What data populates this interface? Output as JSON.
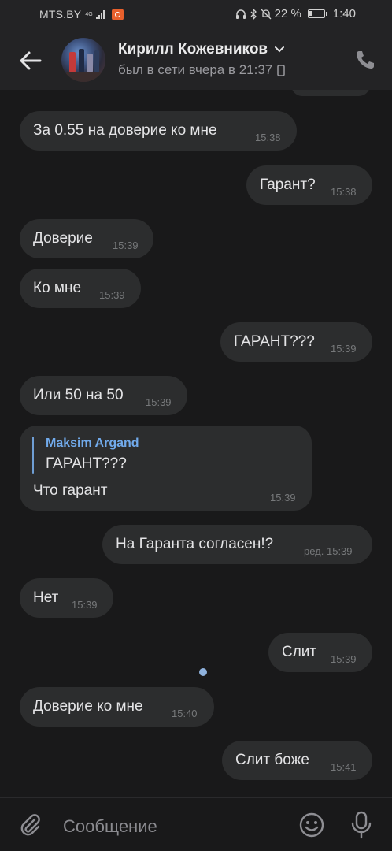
{
  "status_bar": {
    "carrier": "MTS.BY",
    "network": "4G",
    "battery_percent": "22 %",
    "battery_level": 0.22,
    "time": "1:40"
  },
  "header": {
    "contact_name": "Кирилл Кожевников",
    "last_seen": "был в сети вчера в 21:37",
    "icons": [
      "back-arrow-icon",
      "chevron-down-icon",
      "mobile-device-icon",
      "phone-icon"
    ]
  },
  "messages": [
    {
      "side": "in",
      "text": "За 0.55 на доверие ко мне",
      "time": "15:38"
    },
    {
      "side": "out",
      "text": "Гарант?",
      "time": "15:38"
    },
    {
      "side": "in",
      "text": "Доверие",
      "time": "15:39"
    },
    {
      "side": "in",
      "text": "Ко мне",
      "time": "15:39"
    },
    {
      "side": "out",
      "text": "ГАРАНТ???",
      "time": "15:39"
    },
    {
      "side": "in",
      "text": "Или 50 на 50",
      "time": "15:39"
    },
    {
      "side": "in",
      "reply_author": "Maksim Argand",
      "reply_text": "ГАРАНТ???",
      "text": "Что гарант",
      "time": "15:39"
    },
    {
      "side": "out",
      "text": "На Гаранта согласен!?",
      "time": "ред. 15:39"
    },
    {
      "side": "in",
      "text": "Нет",
      "time": "15:39"
    },
    {
      "side": "out",
      "text": "Слит",
      "time": "15:39"
    },
    {
      "side": "in",
      "text": "Доверие ко мне",
      "time": "15:40"
    },
    {
      "side": "out",
      "text": "Слит боже",
      "time": "15:41",
      "unread": true
    }
  ],
  "composer": {
    "placeholder": "Сообщение",
    "icons": [
      "attach-icon",
      "emoji-icon",
      "microphone-icon"
    ]
  },
  "colors": {
    "background": "#19191a",
    "bubble": "#2c2d2e",
    "header": "#232325",
    "accent": "#71aaeb"
  }
}
